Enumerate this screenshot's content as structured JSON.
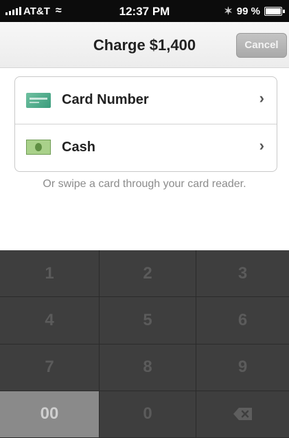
{
  "status_bar": {
    "carrier": "AT&T",
    "time": "12:37 PM",
    "battery": "99 %"
  },
  "nav": {
    "title": "Charge $1,400",
    "cancel_label": "Cancel"
  },
  "payment_options": [
    {
      "label": "Card Number",
      "icon": "credit-card-icon"
    },
    {
      "label": "Cash",
      "icon": "cash-icon"
    }
  ],
  "swipe_hint": "Or swipe a card through your card reader.",
  "keypad": {
    "keys": [
      "1",
      "2",
      "3",
      "4",
      "5",
      "6",
      "7",
      "8",
      "9",
      "00",
      "0"
    ],
    "backspace_icon": "backspace-icon"
  },
  "colors": {
    "keypad_bg": "#3e3e3e",
    "cancel_bg": "#b3b3b3"
  }
}
